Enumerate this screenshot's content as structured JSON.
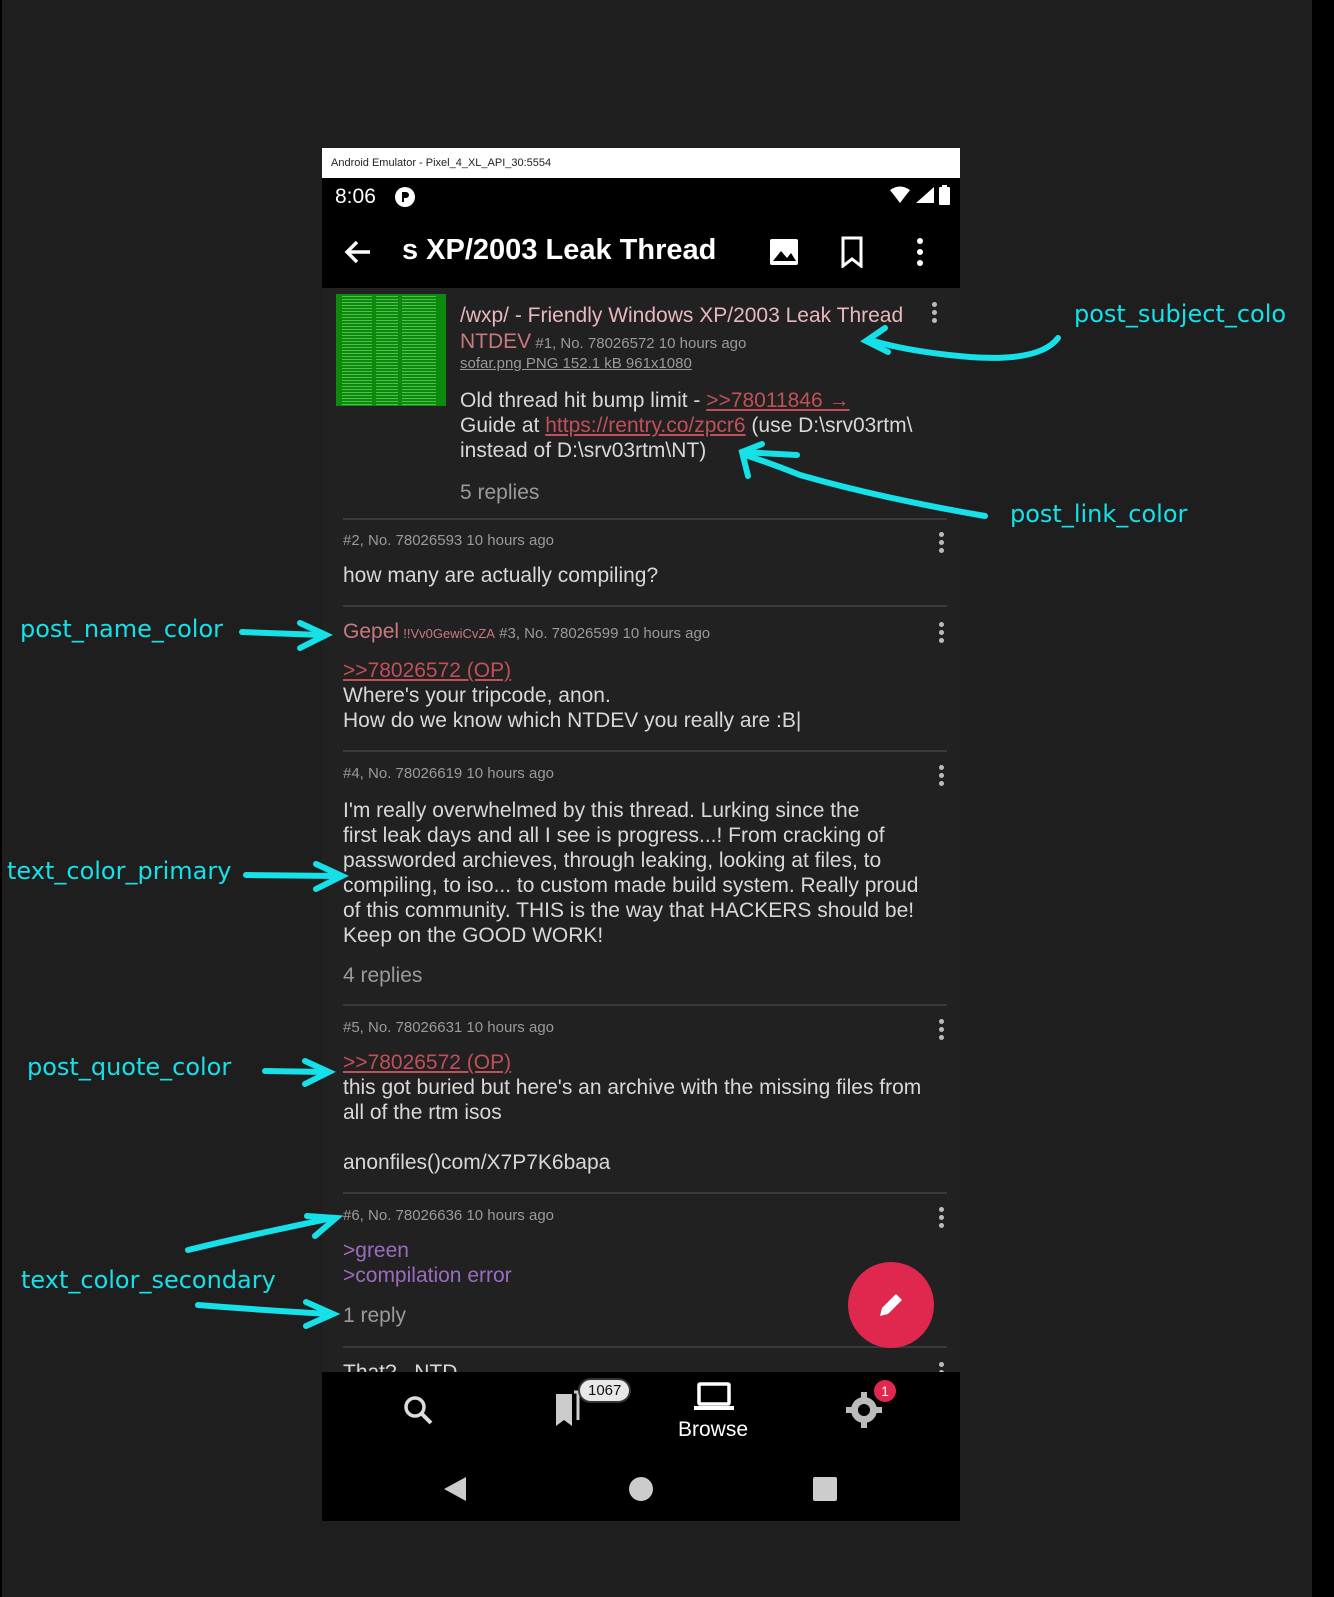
{
  "emulator": {
    "title": "Android Emulator - Pixel_4_XL_API_30:5554"
  },
  "statusbar": {
    "time": "8:06"
  },
  "appbar": {
    "title": "s XP/2003 Leak Thread",
    "actions": [
      "back-arrow-icon",
      "image-icon",
      "bookmark-icon",
      "more-vert-icon"
    ]
  },
  "posts": {
    "op": {
      "subject": "/wxp/ - Friendly Windows XP/2003 Leak Thread",
      "name": "NTDEV",
      "meta": "#1, No. 78026572 10 hours ago",
      "file": "sofar.png PNG 152.1 kB 961x1080",
      "line1_text": "Old thread hit bump limit - ",
      "line1_link": ">>78011846 →",
      "line2_text": "Guide at ",
      "line2_link": "https://rentry.co/zpcr6",
      "line2_rest": " (use D:\\srv03rtm\\",
      "line3": "instead of D:\\srv03rtm\\NT)",
      "replies": "5 replies"
    },
    "p2": {
      "meta": "#2, No. 78026593 10 hours ago",
      "body": "how many are actually compiling?"
    },
    "p3": {
      "name": "Gepel",
      "trip": "!!Vv0GewiCvZA",
      "meta": "#3, No. 78026599 10 hours ago",
      "quote": ">>78026572 (OP)",
      "line1": "Where's your tripcode, anon.",
      "line2": "How do we know which NTDEV you really are :B|"
    },
    "p4": {
      "meta": "#4, No. 78026619 10 hours ago",
      "lines": [
        "I'm really overwhelmed by this thread. Lurking since the",
        "first leak days and all I see is progress...! From cracking of",
        "passworded archieves, through leaking, looking at files, to",
        "compiling, to iso... to custom made build system. Really proud",
        "of this community. THIS is the way that HACKERS should be!",
        "Keep on the GOOD WORK!"
      ],
      "replies": "4 replies"
    },
    "p5": {
      "meta": "#5, No. 78026631 10 hours ago",
      "quote": ">>78026572 (OP)",
      "line1": "this got buried but here's an archive with the missing files from",
      "line2": "all of the rtm isos",
      "line3": "anonfiles()com/X7P7K6bapa"
    },
    "p6": {
      "meta": "#6, No. 78026636 10 hours ago",
      "green1": ">green",
      "green2": ">compilation error",
      "replies": "1 reply"
    },
    "p7_partial": "That?...NTD..."
  },
  "bottomnav": {
    "bookmark_count": "1067",
    "browse_label": "Browse",
    "settings_badge": "1"
  },
  "annotations": {
    "post_subject_color": "post_subject_colo",
    "post_link_color": "post_link_color",
    "post_name_color": "post_name_color",
    "text_color_primary": "text_color_primary",
    "post_quote_color": "post_quote_color",
    "text_color_secondary": "text_color_secondary"
  },
  "colors": {
    "annotation": "#16e0e8",
    "fab": "#e0284e",
    "name": "#c9797d",
    "link": "#c0505a",
    "greentext": "#9a6cc0"
  }
}
